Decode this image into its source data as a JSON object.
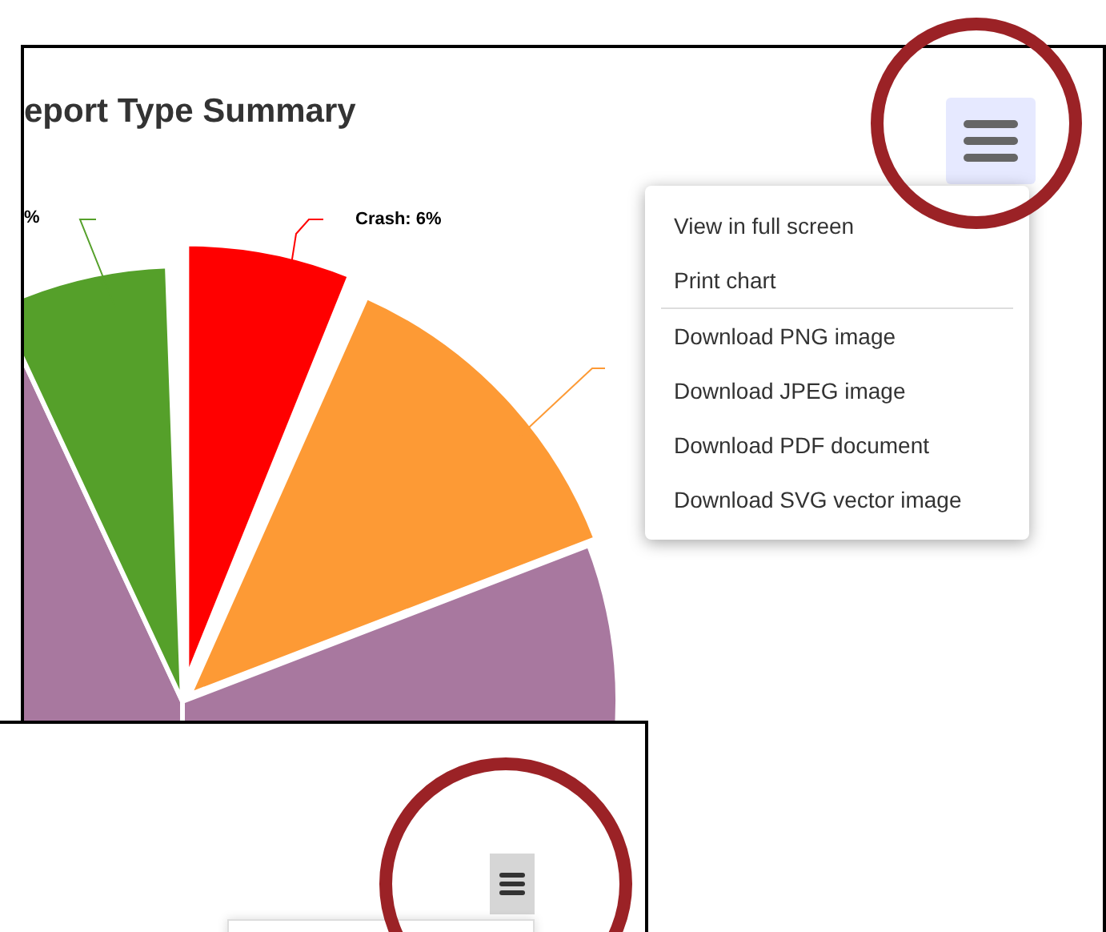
{
  "chart": {
    "title": "eport Type Summary",
    "labels": [
      "%",
      "Crash: 6%"
    ]
  },
  "menu": {
    "items": [
      {
        "label": "View in full screen",
        "kind": "item"
      },
      {
        "label": "Print chart",
        "kind": "item"
      },
      {
        "kind": "separator"
      },
      {
        "label": "Download PNG image",
        "kind": "item"
      },
      {
        "label": "Download JPEG image",
        "kind": "item"
      },
      {
        "label": "Download PDF document",
        "kind": "item"
      },
      {
        "label": "Download SVG vector image",
        "kind": "item"
      }
    ]
  }
}
